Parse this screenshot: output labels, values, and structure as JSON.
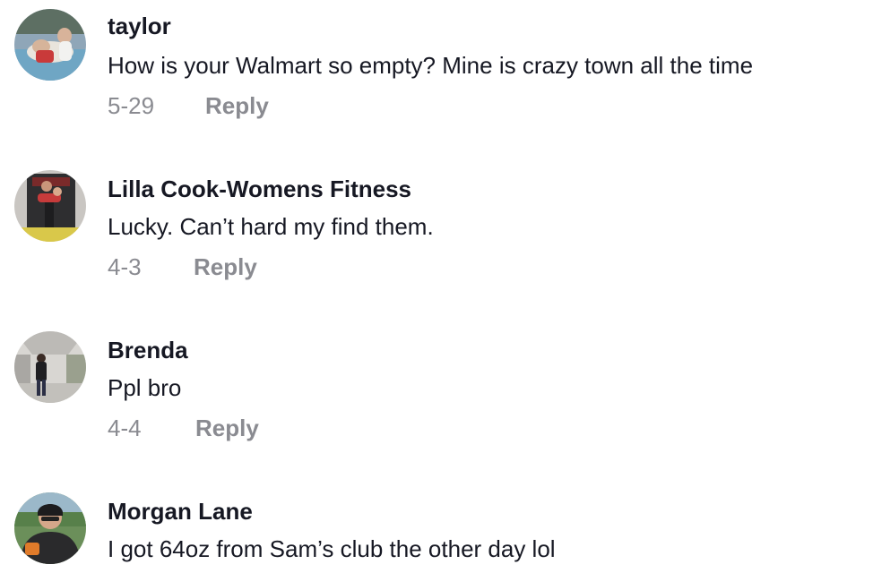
{
  "comments": [
    {
      "username": "taylor",
      "text": "How is your Walmart so empty? Mine is crazy town all the time",
      "date": "5-29",
      "reply_label": "Reply",
      "avatar_icon": "profile-photo-pool"
    },
    {
      "username": "Lilla Cook-Womens Fitness",
      "text": "Lucky. Can’t hard my find them.",
      "date": "4-3",
      "reply_label": "Reply",
      "avatar_icon": "profile-photo-fitness"
    },
    {
      "username": "Brenda",
      "text": "Ppl bro",
      "date": "4-4",
      "reply_label": "Reply",
      "avatar_icon": "profile-photo-hallway"
    },
    {
      "username": "Morgan Lane",
      "text": "I got 64oz from Sam’s club the other day lol",
      "avatar_icon": "profile-photo-stadium"
    }
  ],
  "colors": {
    "primary_text": "#161823",
    "secondary_text": "#8a8b91",
    "background": "#ffffff"
  }
}
